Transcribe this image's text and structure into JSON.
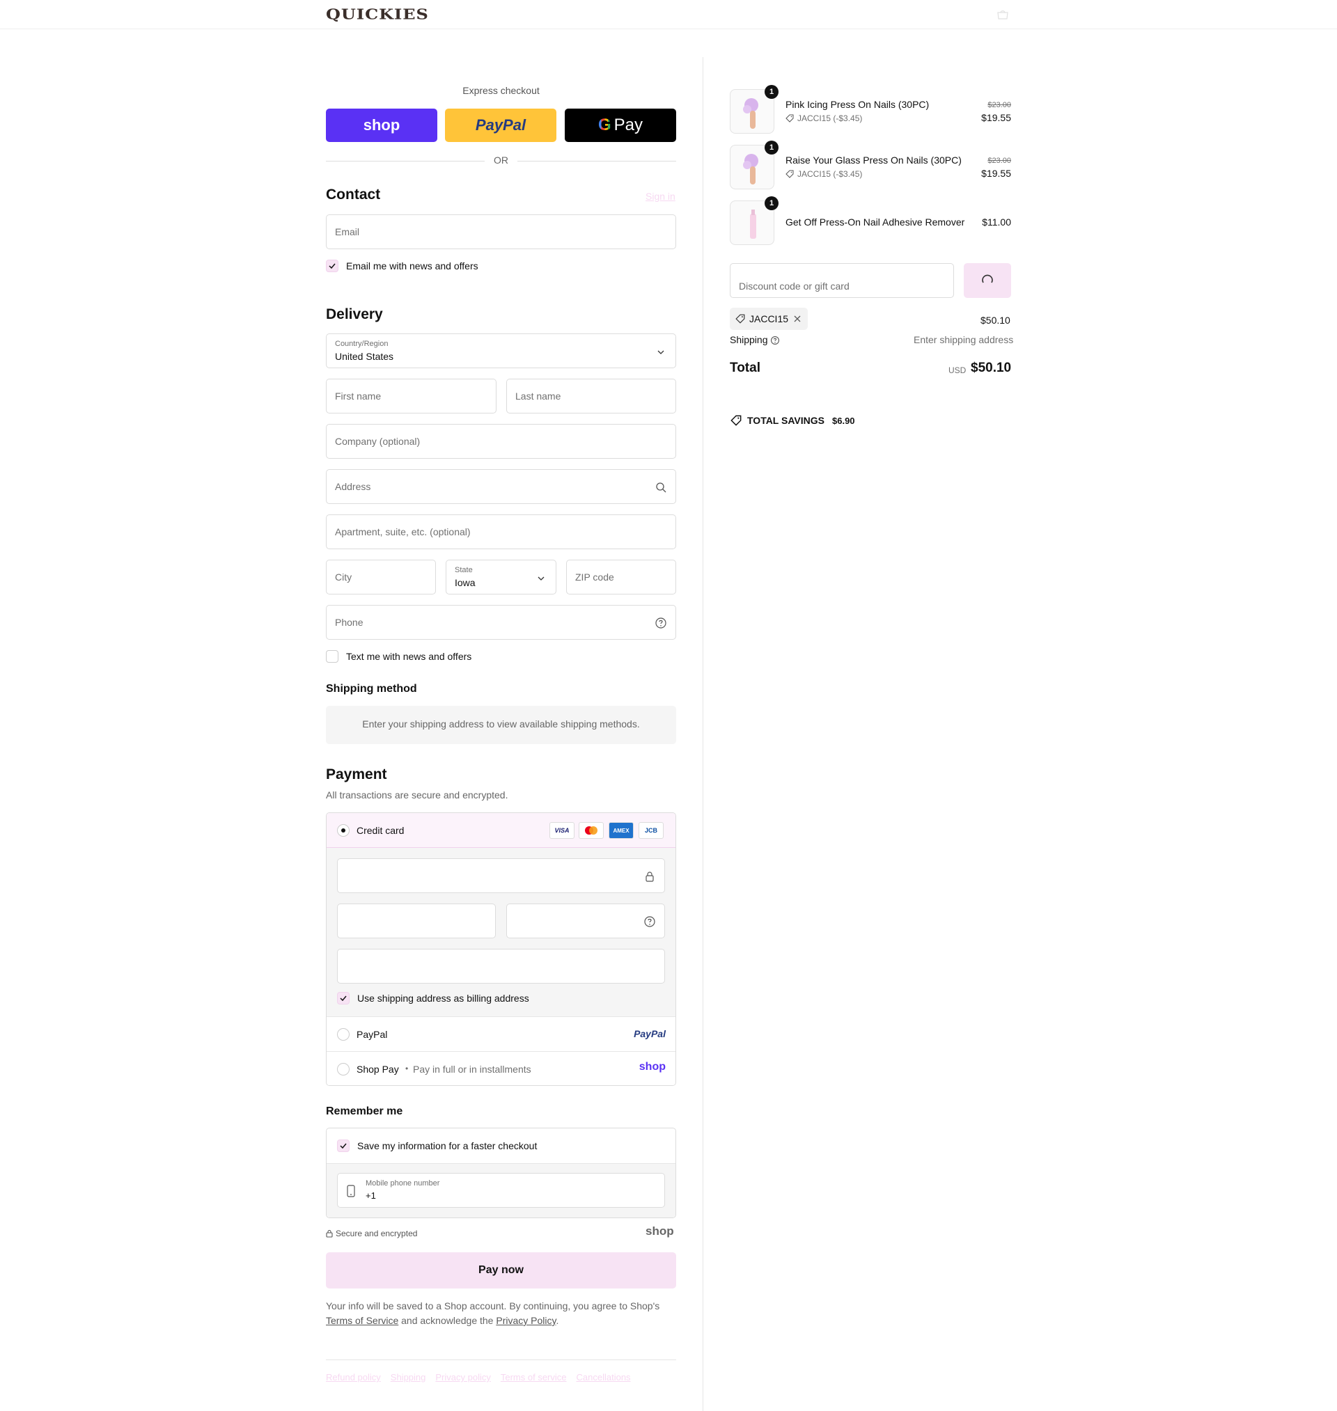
{
  "header": {
    "logo": "QUICKIES",
    "cart_icon": "bag-icon"
  },
  "express": {
    "title": "Express checkout",
    "shop_label": "shop",
    "paypal_label": "PayPal",
    "gpay_g": "G",
    "gpay_label": "Pay",
    "or": "OR"
  },
  "contact": {
    "heading": "Contact",
    "sign_in": "Sign in",
    "email_placeholder": "Email",
    "news_label": "Email me with news and offers"
  },
  "delivery": {
    "heading": "Delivery",
    "country_label": "Country/Region",
    "country_value": "United States",
    "first_name": "First name",
    "last_name": "Last name",
    "company": "Company (optional)",
    "address": "Address",
    "apartment": "Apartment, suite, etc. (optional)",
    "city": "City",
    "state_label": "State",
    "state_value": "Iowa",
    "zip": "ZIP code",
    "phone": "Phone",
    "text_label": "Text me with news and offers"
  },
  "shipping_method": {
    "heading": "Shipping method",
    "message": "Enter your shipping address to view available shipping methods."
  },
  "payment": {
    "heading": "Payment",
    "subtitle": "All transactions are secure and encrypted.",
    "credit_card": "Credit card",
    "card_logos": [
      "VISA",
      "MC",
      "AMEX",
      "JCB"
    ],
    "billing_label": "Use shipping address as billing address",
    "paypal": "PayPal",
    "paypal_logo": "PayPal",
    "shop_pay": "Shop Pay",
    "shop_pay_dot": "•",
    "shop_pay_sub": "Pay in full or in installments",
    "shop_logo": "shop"
  },
  "remember": {
    "heading": "Remember me",
    "save_label": "Save my information for a faster checkout",
    "mobile_label": "Mobile phone number",
    "mobile_value": "+1"
  },
  "secure": {
    "label": "Secure and encrypted",
    "shop_logo": "shop"
  },
  "pay_now": "Pay now",
  "legal": {
    "text1": "Your info will be saved to a Shop account. By continuing, you agree to Shop's ",
    "terms": "Terms of Service",
    "text2": " and acknowledge the ",
    "privacy": "Privacy Policy",
    "text3": "."
  },
  "footer": {
    "links": [
      "Refund policy",
      "Shipping",
      "Privacy policy",
      "Terms of service",
      "Cancellations"
    ]
  },
  "cart": {
    "items": [
      {
        "qty": "1",
        "name": "Pink Icing Press On Nails (30PC)",
        "discount": "JACCI15 (-$3.45)",
        "old_price": "$23.00",
        "price": "$19.55"
      },
      {
        "qty": "1",
        "name": "Raise Your Glass Press On Nails (30PC)",
        "discount": "JACCI15 (-$3.45)",
        "old_price": "$23.00",
        "price": "$19.55"
      },
      {
        "qty": "1",
        "name": "Get Off Press-On Nail Adhesive Remover",
        "price": "$11.00"
      }
    ],
    "discount_placeholder": "Discount code or gift card",
    "code_chip": "JACCI15",
    "subtotal": "$50.10",
    "shipping_label": "Shipping",
    "shipping_value": "Enter shipping address",
    "total_label": "Total",
    "currency": "USD",
    "total_value": "$50.10",
    "savings_label": "TOTAL SAVINGS",
    "savings_value": "$6.90"
  },
  "colors": {
    "accent": "#f7e3f4",
    "shop_purple": "#5a31f4",
    "paypal_yellow": "#ffc439",
    "link_pink": "#f7d9f2"
  }
}
